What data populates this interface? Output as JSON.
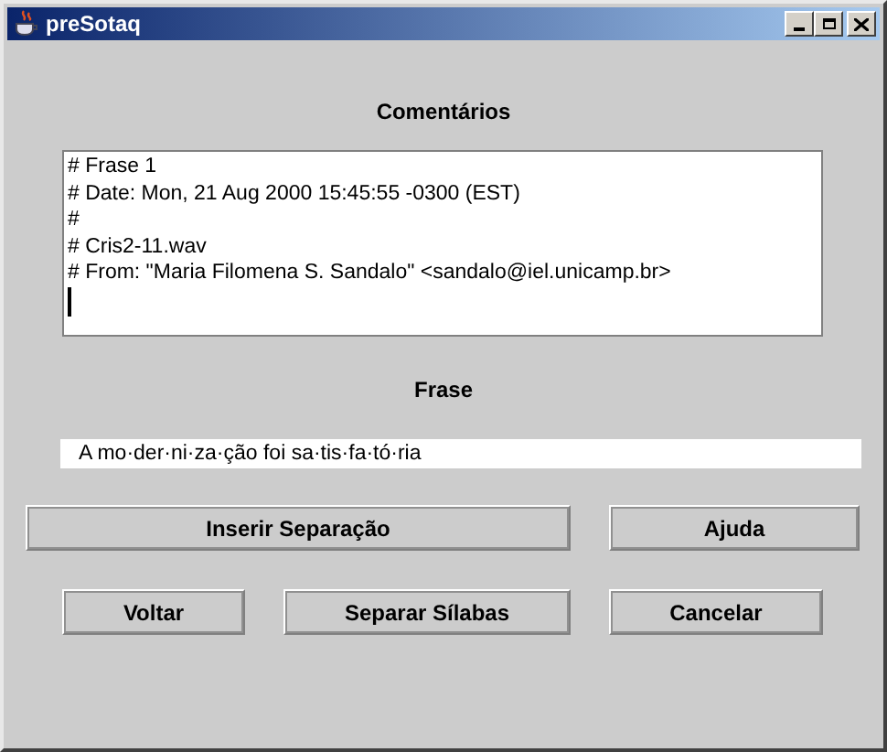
{
  "window": {
    "title": "preSotaq"
  },
  "comments": {
    "label": "Comentários",
    "lines": [
      "# Frase 1",
      "# Date: Mon, 21 Aug 2000 15:45:55 -0300 (EST)",
      "#",
      "# Cris2-11.wav",
      "# From: \"Maria Filomena S. Sandalo\" <sandalo@iel.unicamp.br>"
    ]
  },
  "phrase": {
    "label": "Frase",
    "value": "A mo·der·ni·za·ção foi sa·tis·fa·tó·ria"
  },
  "buttons": [
    {
      "label": "Inserir Separação",
      "kind": "wide"
    },
    {
      "label": "Ajuda",
      "kind": "side"
    },
    {
      "label": "Voltar",
      "kind": "small"
    },
    {
      "label": "Separar Sílabas",
      "kind": "mid"
    },
    {
      "label": "Cancelar",
      "kind": "side2"
    }
  ]
}
